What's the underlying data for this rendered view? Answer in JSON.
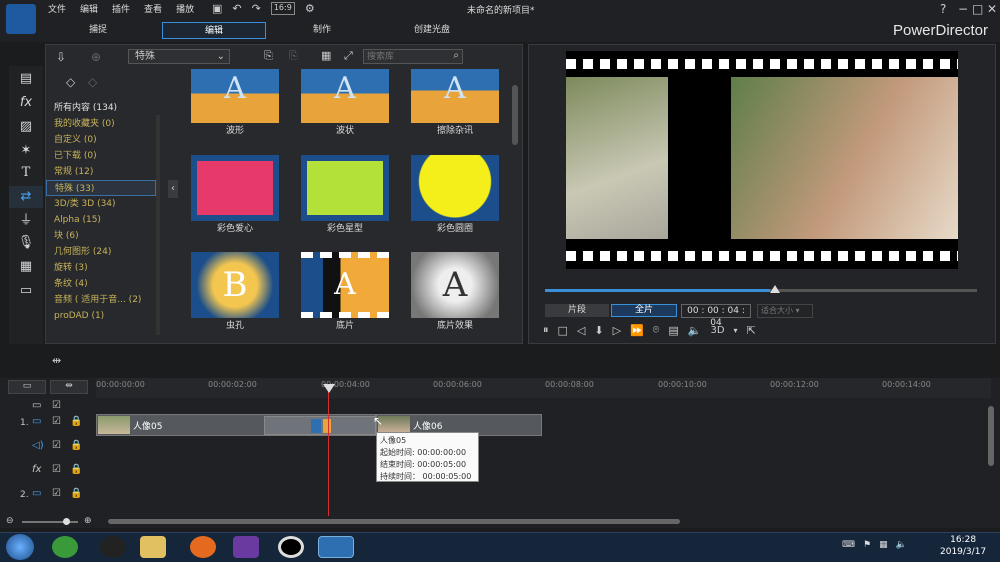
{
  "app": {
    "brand": "PowerDirector",
    "title": "未命名的新项目*",
    "logo_icon": "cyberlink-logo-icon"
  },
  "menu": [
    "文件",
    "编辑",
    "插件",
    "查看",
    "播放"
  ],
  "tabs": [
    "捕捉",
    "编辑",
    "制作",
    "创建光盘"
  ],
  "toolbar": {
    "filter_value": "特殊",
    "search_placeholder": "搜索库"
  },
  "categories": [
    "所有内容 (134)",
    "我的收藏夹  (0)",
    "自定义  (0)",
    "已下载  (0)",
    "常规  (12)",
    "特殊  (33)",
    "3D/类 3D  (34)",
    "Alpha  (15)",
    "块  (6)",
    "几何图形  (24)",
    "旋转  (3)",
    "条纹  (4)",
    "音频 ( 适用于音...  (2)",
    "proDAD  (1)"
  ],
  "thumbs": [
    "波形",
    "波状",
    "擦除杂讯",
    "彩色爱心",
    "彩色星型",
    "彩色圆圈",
    "虫孔",
    "底片",
    "底片效果"
  ],
  "thumb_chars": [
    "A",
    "A",
    "A",
    "",
    "",
    "",
    "B",
    "A",
    "A"
  ],
  "preview": {
    "mode_clip": "片段",
    "mode_full": "全片",
    "timecode": "00 : 00 : 04 : 04",
    "fit": "适合大小",
    "mode3d": "3D"
  },
  "ruler": [
    "00:00:00:00",
    "00:00:02:00",
    "00:00:04:00",
    "00:00:06:00",
    "00:00:08:00",
    "00:00:10:00",
    "00:00:12:00",
    "00:00:14:00"
  ],
  "tracks": {
    "t1": "1.",
    "t2": "2."
  },
  "clips": {
    "a": "人像05",
    "b": "人像06"
  },
  "tooltip": {
    "name": "人像05",
    "start": "起始时间: 00:00:00:00",
    "end": "结束时间: 00:00:05:00",
    "dur": "持续时间：  00:00:05:00"
  },
  "clock": {
    "time": "16:28",
    "date": "2019/3/17"
  },
  "colors": {
    "accent": "#3a8fd8",
    "category_text": "#c7b35a"
  }
}
